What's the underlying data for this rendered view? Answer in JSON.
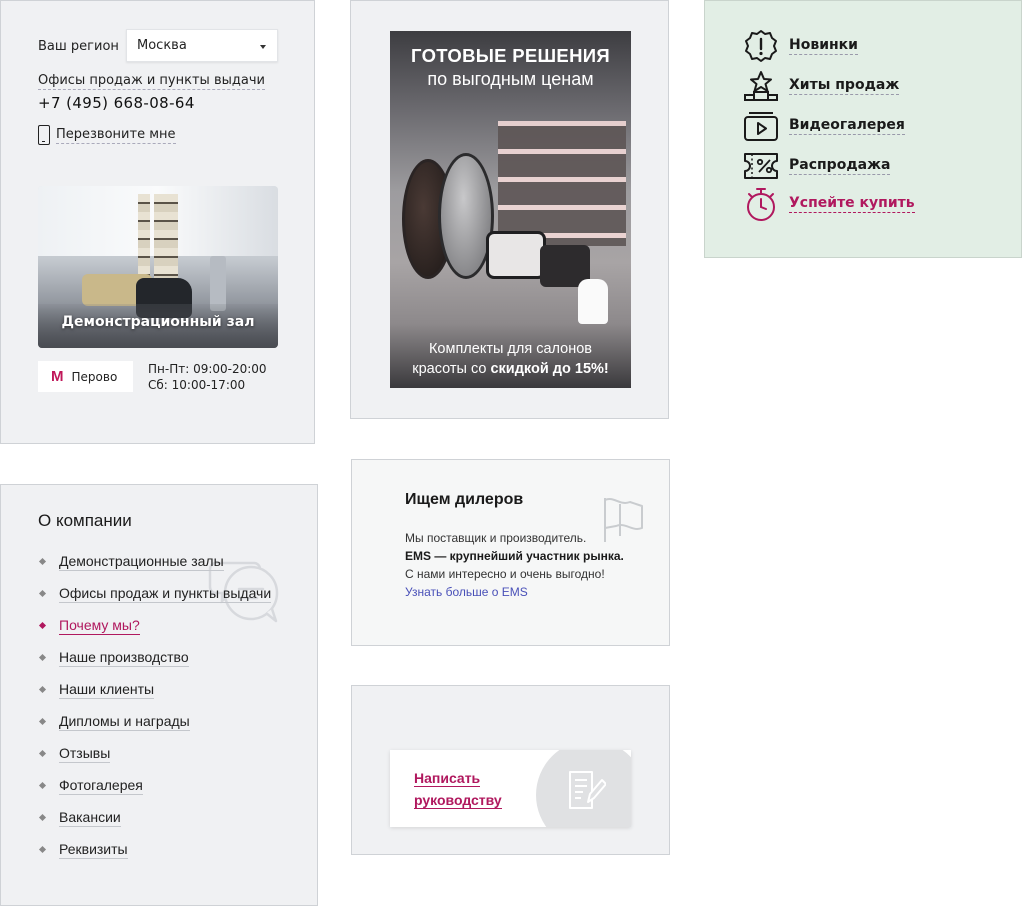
{
  "region": {
    "label": "Ваш регион",
    "selected": "Москва",
    "offices_link": "Офисы продаж и пункты выдачи",
    "phone": "+7 (495) 668-08-64",
    "callback_label": "Перезвоните мне",
    "demo_caption": "Демонстрационный зал",
    "metro": "Перово",
    "metro_logo": "M",
    "hours_weekdays": "Пн-Пт: 09:00-20:00",
    "hours_saturday": "Сб: 10:00-17:00"
  },
  "banner": {
    "title": "ГОТОВЫЕ РЕШЕНИЯ",
    "subtitle": "по выгодным ценам",
    "bottom_line1": "Комплекты для салонов",
    "bottom_line2_plain": "красоты со",
    "bottom_line2_bold": "скидкой до 15%!"
  },
  "quick": {
    "items": [
      {
        "label": "Новинки",
        "icon": "exclamation-badge-icon"
      },
      {
        "label": "Хиты продаж",
        "icon": "star-podium-icon"
      },
      {
        "label": "Видеогалерея",
        "icon": "video-play-icon"
      },
      {
        "label": "Распродажа",
        "icon": "percent-ticket-icon"
      },
      {
        "label": "Успейте купить",
        "icon": "stopwatch-icon"
      }
    ],
    "accent_color": "#b0185e"
  },
  "about": {
    "title": "О компании",
    "items": [
      {
        "label": "Демонстрационные залы"
      },
      {
        "label": "Офисы продаж и пункты выдачи"
      },
      {
        "label": "Почему мы?",
        "active": true
      },
      {
        "label": "Наше производство"
      },
      {
        "label": "Наши клиенты"
      },
      {
        "label": "Дипломы и награды"
      },
      {
        "label": "Отзывы"
      },
      {
        "label": "Фотогалерея"
      },
      {
        "label": "Вакансии"
      },
      {
        "label": "Реквизиты"
      }
    ]
  },
  "dealers": {
    "title": "Ищем дилеров",
    "line1": "Мы поставщик и производитель.",
    "line2_bold": "EMS — крупнейший участник рынка.",
    "line3": "С нами интересно и очень выгодно!",
    "link": "Узнать больше о EMS"
  },
  "write": {
    "line1": "Написать",
    "line2": "руководству"
  }
}
